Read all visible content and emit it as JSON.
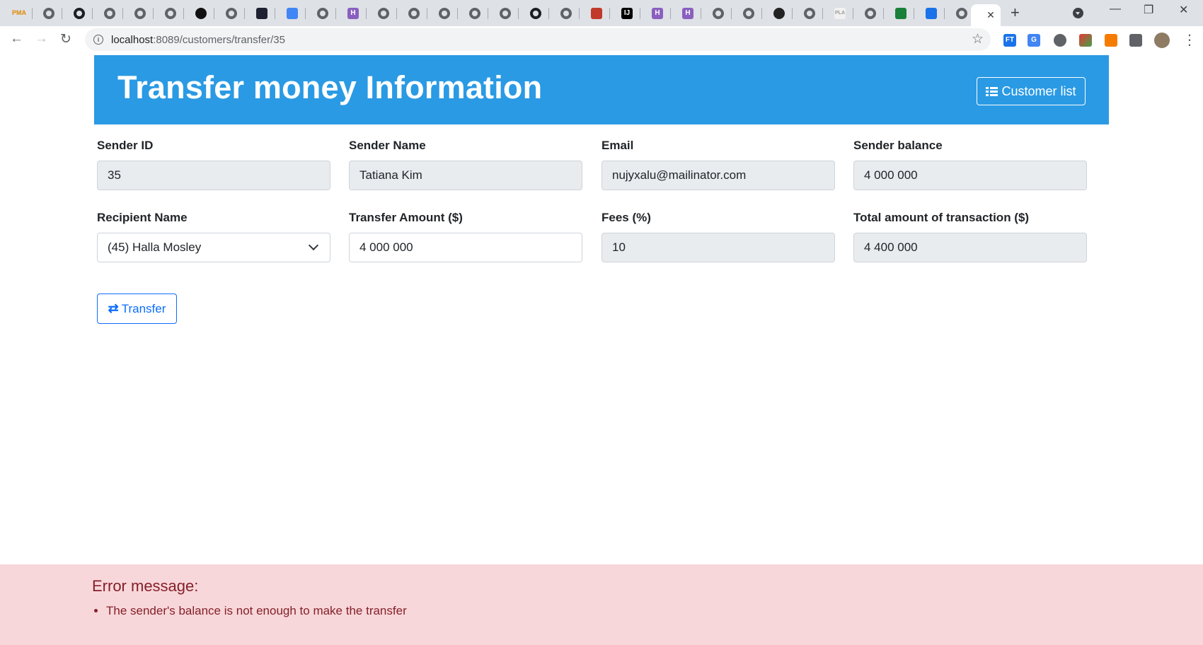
{
  "browser": {
    "url_host": "localhost",
    "url_path": ":8089/customers/transfer/35",
    "tabs": [
      {
        "icon": "pma-icon",
        "label": "PMA"
      },
      {
        "icon": "globe-icon"
      },
      {
        "icon": "github-icon"
      },
      {
        "icon": "globe-icon"
      },
      {
        "icon": "globe-icon"
      },
      {
        "icon": "globe-icon"
      },
      {
        "icon": "dark-circle-icon"
      },
      {
        "icon": "globe-icon"
      },
      {
        "icon": "dark-square-icon"
      },
      {
        "icon": "translate-icon"
      },
      {
        "icon": "globe-icon"
      },
      {
        "icon": "h-icon",
        "label": "H"
      },
      {
        "icon": "globe-icon"
      },
      {
        "icon": "globe-icon"
      },
      {
        "icon": "globe-icon"
      },
      {
        "icon": "globe-icon"
      },
      {
        "icon": "globe-icon"
      },
      {
        "icon": "github-icon"
      },
      {
        "icon": "globe-icon"
      },
      {
        "icon": "house-icon"
      },
      {
        "icon": "intellij-icon",
        "label": "IJ"
      },
      {
        "icon": "h-icon",
        "label": "H"
      },
      {
        "icon": "h-icon",
        "label": "H"
      },
      {
        "icon": "globe-icon"
      },
      {
        "icon": "globe-icon"
      },
      {
        "icon": "eye-icon"
      },
      {
        "icon": "globe-icon"
      },
      {
        "icon": "pla-icon",
        "label": "PLA"
      },
      {
        "icon": "globe-icon"
      },
      {
        "icon": "green-square-icon"
      },
      {
        "icon": "contacts-icon"
      },
      {
        "icon": "globe-icon"
      }
    ]
  },
  "header": {
    "title": "Transfer money Information",
    "customer_list_label": "Customer list"
  },
  "form": {
    "sender_id": {
      "label": "Sender ID",
      "value": "35"
    },
    "sender_name": {
      "label": "Sender Name",
      "value": "Tatiana Kim"
    },
    "email": {
      "label": "Email",
      "value": "nujyxalu@mailinator.com"
    },
    "sender_balance": {
      "label": "Sender balance",
      "value": "4 000 000"
    },
    "recipient": {
      "label": "Recipient Name",
      "value": "(45) Halla Mosley"
    },
    "transfer_amount": {
      "label": "Transfer Amount ($)",
      "value": "4 000 000"
    },
    "fees": {
      "label": "Fees (%)",
      "value": "10"
    },
    "total": {
      "label": "Total amount of transaction ($)",
      "value": "4 400 000"
    },
    "transfer_label": "Transfer"
  },
  "error": {
    "title": "Error message:",
    "items": [
      "The sender's balance is not enough to make the transfer"
    ]
  },
  "colors": {
    "header_bg": "#2a9ae4",
    "error_bg": "#f8d7da",
    "error_text": "#842029",
    "primary": "#0d6efd"
  }
}
